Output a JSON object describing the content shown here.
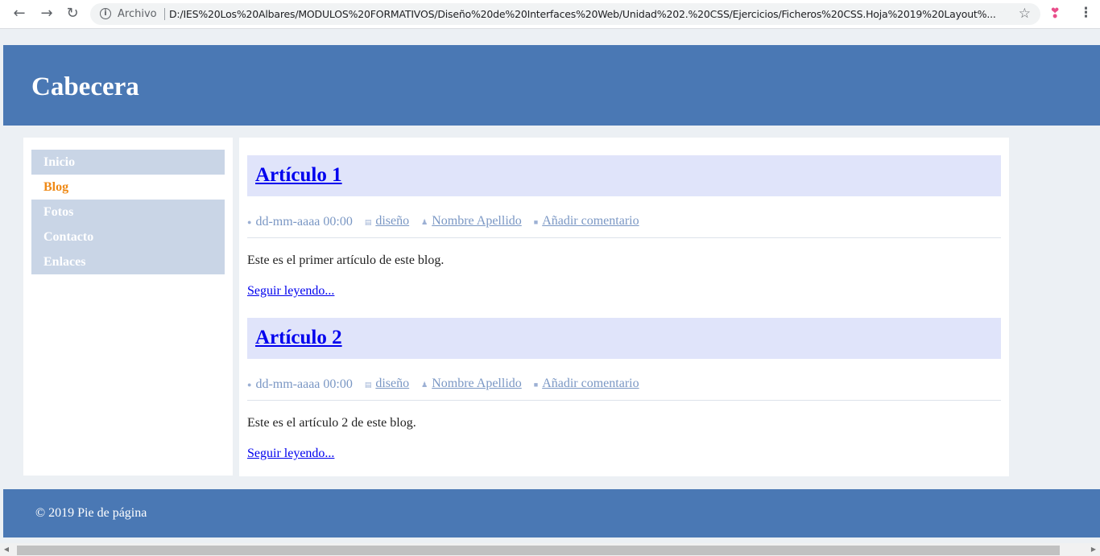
{
  "browser": {
    "back_icon": "back-arrow-icon",
    "forward_icon": "forward-arrow-icon",
    "reload_icon": "reload-icon",
    "security_label": "Archivo",
    "url": "D:/IES%20Los%20Albares/MODULOS%20FORMATIVOS/Diseño%20de%20Interfaces%20Web/Unidad%202.%20CSS/Ejercicios/Ficheros%20CSS.Hoja%2019%20Layout%...",
    "bookmark_icon": "star-icon",
    "extension_icon": "butterfly-extension-icon",
    "menu_icon": "kebab-menu-icon"
  },
  "header": {
    "title": "Cabecera"
  },
  "menu": {
    "items": [
      {
        "label": "Inicio",
        "active": false
      },
      {
        "label": "Blog",
        "active": true
      },
      {
        "label": "Fotos",
        "active": false
      },
      {
        "label": "Contacto",
        "active": false
      },
      {
        "label": "Enlaces",
        "active": false
      }
    ]
  },
  "articles": [
    {
      "title": "Artículo 1",
      "date": "dd-mm-aaaa 00:00",
      "category": "diseño",
      "author": "Nombre Apellido",
      "comment": "Añadir comentario",
      "text": "Este es el primer artículo de este blog.",
      "read_more": "Seguir leyendo..."
    },
    {
      "title": "Artículo 2",
      "date": "dd-mm-aaaa 00:00",
      "category": "diseño",
      "author": "Nombre Apellido",
      "comment": "Añadir comentario",
      "text": "Este es el artículo 2 de este blog.",
      "read_more": "Seguir leyendo..."
    }
  ],
  "footer": {
    "text": "© 2019 Pie de página"
  },
  "colors": {
    "header_bg": "#4a78b4",
    "menu_bg": "#c9d5e6",
    "menu_active": "#ef8a17",
    "article_title_bg": "#e0e4fa",
    "meta_text": "#7a97c4",
    "link": "#0000ee"
  }
}
